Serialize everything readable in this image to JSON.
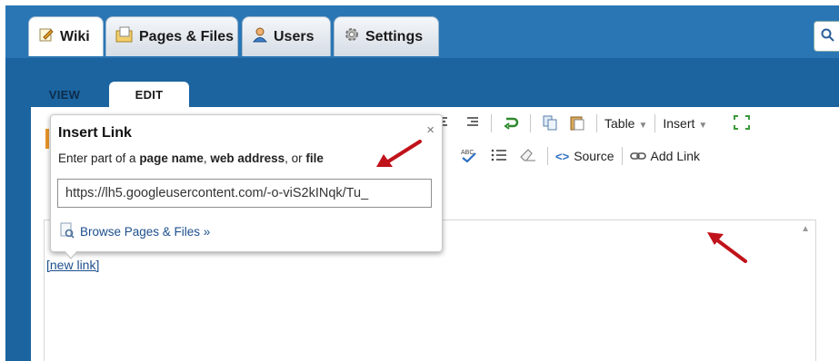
{
  "main_tabs": [
    {
      "label": "Wiki",
      "icon": "edit-page-icon"
    },
    {
      "label": "Pages & Files",
      "icon": "folder-pages-icon"
    },
    {
      "label": "Users",
      "icon": "user-icon"
    },
    {
      "label": "Settings",
      "icon": "gear-icon"
    }
  ],
  "search": {
    "icon": "search-icon"
  },
  "sub_tabs": [
    "VIEW",
    "EDIT"
  ],
  "toolbar": {
    "table_label": "Table",
    "insert_label": "Insert",
    "source_label": "Source",
    "add_link_label": "Add Link"
  },
  "editor": {
    "link_text": "[new link]"
  },
  "insert_link": {
    "title": "Insert Link",
    "close": "×",
    "desc_prefix": "Enter part of a ",
    "desc_b1": "page name",
    "desc_sep1": ", ",
    "desc_b2": "web address",
    "desc_sep2": ", or ",
    "desc_b3": "file",
    "input_value": "https://lh5.googleusercontent.com/-o-viS2kINqk/Tu_",
    "browse_label": "Browse Pages & Files »"
  },
  "colors": {
    "header_blue": "#2a76b5",
    "accent_red": "#c0121a",
    "link_blue": "#1d4f8c"
  }
}
